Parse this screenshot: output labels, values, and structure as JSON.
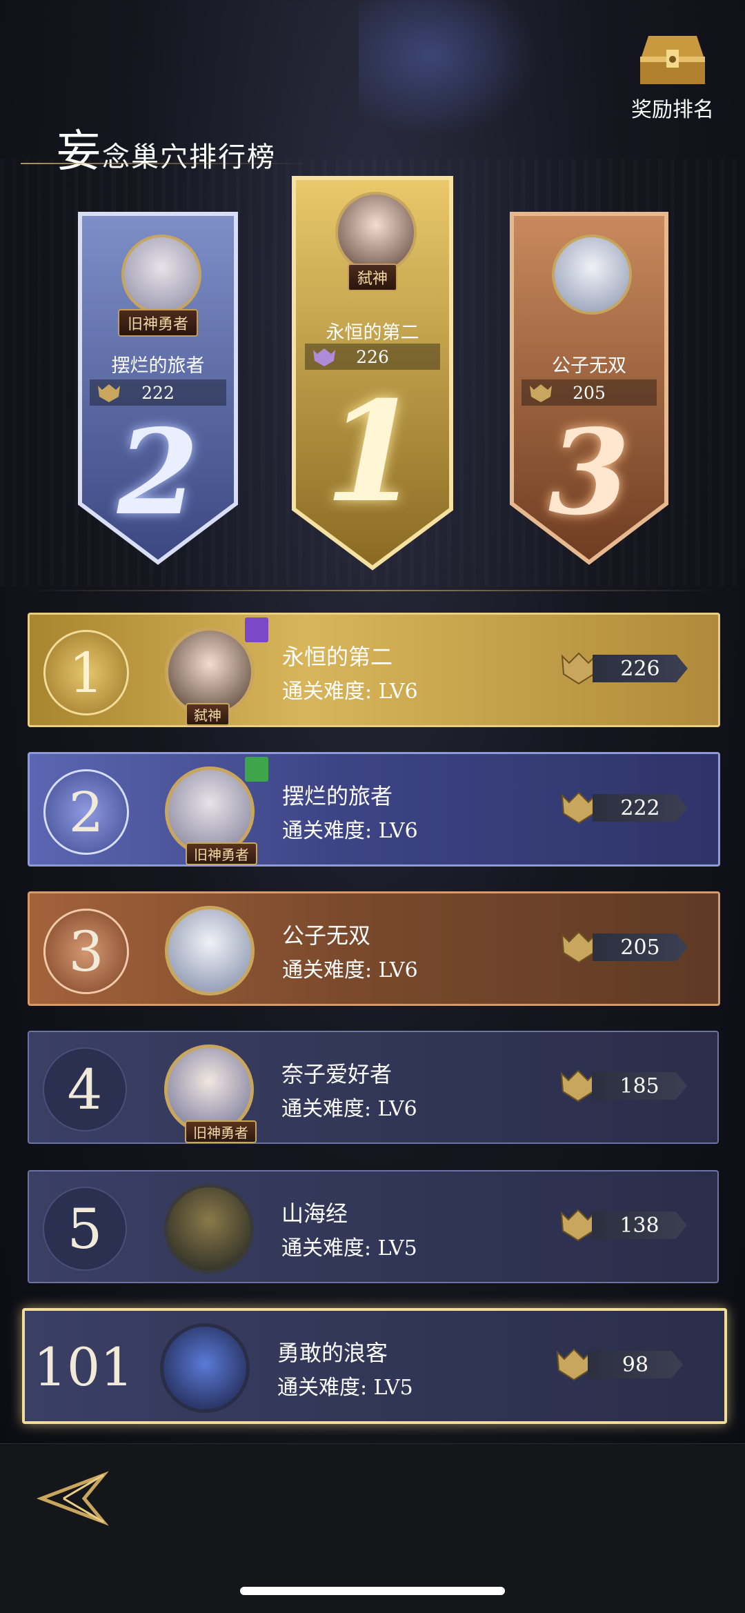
{
  "title": {
    "first_char": "妄",
    "rest": "念巢穴排行榜"
  },
  "reward": {
    "label": "奖励排名"
  },
  "podium": [
    {
      "place": "2",
      "name": "摆烂的旅者",
      "score": "222",
      "tag": "旧神勇者"
    },
    {
      "place": "1",
      "name": "永恒的第二",
      "score": "226",
      "tag": "弑神"
    },
    {
      "place": "3",
      "name": "公子无双",
      "score": "205",
      "tag": ""
    }
  ],
  "rows": [
    {
      "rank": "1",
      "name": "永恒的第二",
      "difficulty": "通关难度: LV6",
      "score": "226",
      "tag": "弑神"
    },
    {
      "rank": "2",
      "name": "摆烂的旅者",
      "difficulty": "通关难度: LV6",
      "score": "222",
      "tag": "旧神勇者"
    },
    {
      "rank": "3",
      "name": "公子无双",
      "difficulty": "通关难度: LV6",
      "score": "205",
      "tag": ""
    },
    {
      "rank": "4",
      "name": "奈子爱好者",
      "difficulty": "通关难度: LV6",
      "score": "185",
      "tag": "旧神勇者"
    },
    {
      "rank": "5",
      "name": "山海经",
      "difficulty": "通关难度: LV5",
      "score": "138",
      "tag": ""
    },
    {
      "rank": "101",
      "name": "勇敢的浪客",
      "difficulty": "通关难度: LV5",
      "score": "98",
      "tag": ""
    }
  ],
  "colors": {
    "gold": "#d9b25a",
    "silver": "#8fa0d8",
    "bronze": "#b8744a",
    "dark_row": "#2a2e4a"
  },
  "icons": {
    "reward": "treasure-chest-icon",
    "score": "crest-icon",
    "back": "back-arrow-icon",
    "badge_purple": "banner-badge-icon",
    "badge_green": "friends-badge-icon"
  }
}
